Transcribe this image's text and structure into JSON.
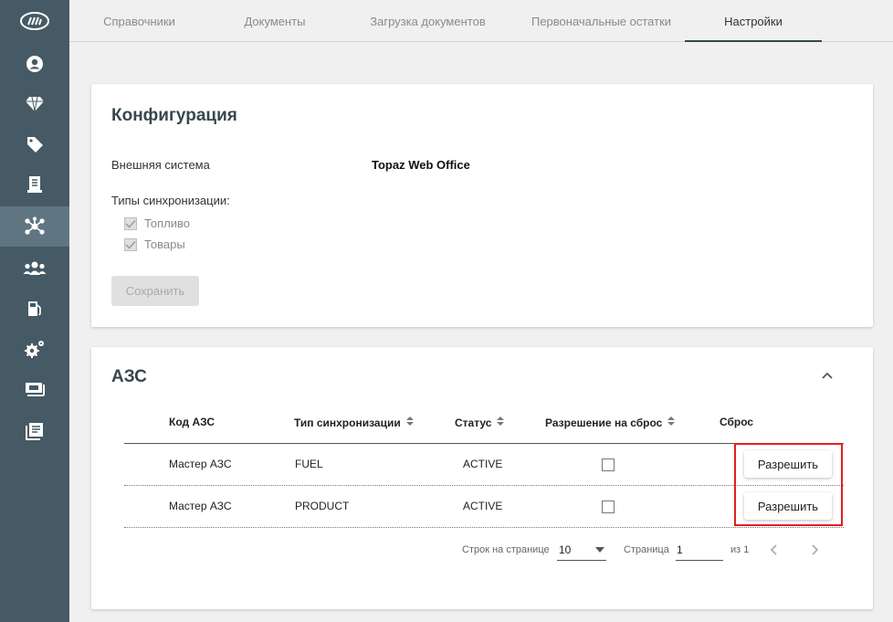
{
  "nav": {
    "tabs": [
      {
        "label": "Справочники"
      },
      {
        "label": "Документы"
      },
      {
        "label": "Загрузка документов"
      },
      {
        "label": "Первоначальные остатки"
      },
      {
        "label": "Настройки"
      }
    ],
    "active_tab": "Настройки"
  },
  "sidebar": {
    "logo": "logo-icon",
    "items": [
      {
        "icon": "user-icon"
      },
      {
        "icon": "diamond-icon"
      },
      {
        "icon": "tag-icon"
      },
      {
        "icon": "document-icon"
      },
      {
        "icon": "network-icon",
        "active": true
      },
      {
        "icon": "users-group-icon"
      },
      {
        "icon": "fuel-station-icon"
      },
      {
        "icon": "gears-icon"
      },
      {
        "icon": "money-icon"
      },
      {
        "icon": "book-icon"
      }
    ]
  },
  "config": {
    "title": "Конфигурация",
    "external_system_label": "Внешняя система",
    "external_system_value": "Topaz Web Office",
    "sync_types_label": "Типы синхронизации:",
    "sync_types": [
      {
        "label": "Топливо",
        "checked": true
      },
      {
        "label": "Товары",
        "checked": true
      }
    ],
    "save_label": "Сохранить"
  },
  "azs": {
    "title": "АЗС",
    "columns": {
      "code": "Код АЗС",
      "sync_type": "Тип синхронизации",
      "status": "Статус",
      "reset_permission": "Разрешение на сброс",
      "reset": "Сброс"
    },
    "rows": [
      {
        "code": "Мастер АЗС",
        "sync_type": "FUEL",
        "status": "ACTIVE",
        "reset_permission": false,
        "reset_label": "Разрешить"
      },
      {
        "code": "Мастер АЗС",
        "sync_type": "PRODUCT",
        "status": "ACTIVE",
        "reset_permission": false,
        "reset_label": "Разрешить"
      }
    ],
    "pagination": {
      "rows_per_page_label": "Строк на странице",
      "rows_per_page": "10",
      "page_label": "Страница",
      "page": "1",
      "of_label": "из 1"
    }
  },
  "colors": {
    "sidebar": "#455a64",
    "highlight": "#e02020"
  }
}
